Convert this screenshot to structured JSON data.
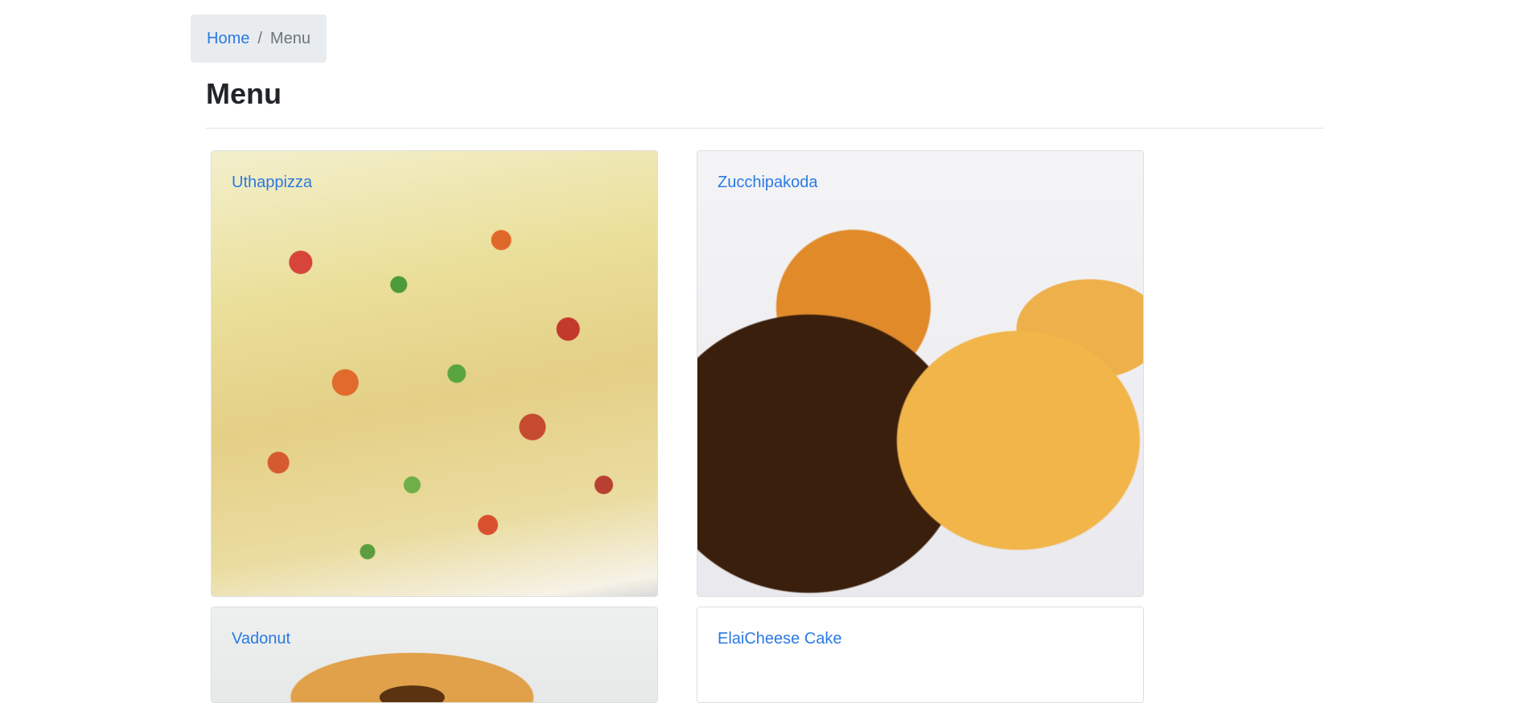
{
  "breadcrumb": {
    "home_label": "Home",
    "separator": "/",
    "current_label": "Menu"
  },
  "page": {
    "title": "Menu"
  },
  "menu": {
    "items": [
      {
        "name": "Uthappizza",
        "image": "pizza-photo"
      },
      {
        "name": "Zucchipakoda",
        "image": "pakoda-photo"
      },
      {
        "name": "Vadonut",
        "image": "vada-photo"
      },
      {
        "name": "ElaiCheese Cake",
        "image": null
      }
    ]
  },
  "colors": {
    "link": "#2a7ae2",
    "breadcrumb_bg": "#e9ecef",
    "muted_text": "#6c757d",
    "divider": "#dee2e6"
  }
}
